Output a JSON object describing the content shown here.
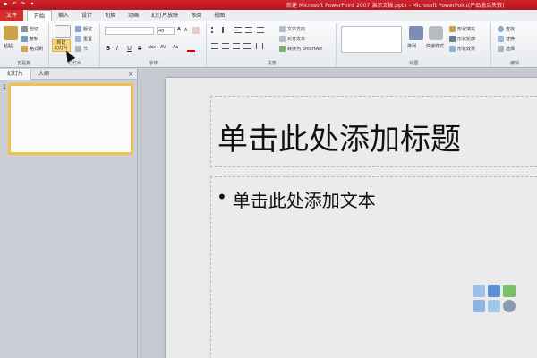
{
  "window": {
    "title": "新建 Microsoft PowerPoint 2007 演示文稿.pptx - Microsoft PowerPoint(产品激活失败)"
  },
  "quick_access": [
    "save-icon",
    "undo-icon",
    "redo-icon",
    "customize-icon"
  ],
  "tabs": [
    {
      "label": "文件",
      "type": "file"
    },
    {
      "label": "开始",
      "active": true
    },
    {
      "label": "插入"
    },
    {
      "label": "设计"
    },
    {
      "label": "切换"
    },
    {
      "label": "动画"
    },
    {
      "label": "幻灯片放映"
    },
    {
      "label": "审阅"
    },
    {
      "label": "视图"
    }
  ],
  "ribbon": {
    "clipboard": {
      "label": "剪贴板",
      "paste": "粘贴",
      "cut": "剪切",
      "copy": "复制",
      "format_painter": "格式刷"
    },
    "slides": {
      "label": "幻灯片",
      "new_slide": "新建\n幻灯片",
      "new_slide_l1": "新建",
      "new_slide_l2": "幻灯片",
      "layout": "版式",
      "reset": "重置",
      "section": "节"
    },
    "font": {
      "label": "字体",
      "font_size": "40",
      "bold": "B",
      "italic": "I",
      "underline": "U",
      "strike": "S",
      "shadow": "abc",
      "spacing": "AV",
      "case": "Aa",
      "grow": "A",
      "shrink": "A"
    },
    "paragraph": {
      "label": "段落",
      "text_direction": "文字方向",
      "align_text": "对齐文本",
      "convert_smartart": "转换为 SmartArt"
    },
    "drawing": {
      "label": "绘图",
      "arrange": "排列",
      "quick_styles": "快速样式",
      "shape_fill": "形状填充",
      "shape_outline": "形状轮廓",
      "shape_effects": "形状效果"
    },
    "editing": {
      "label": "编辑",
      "find": "查找",
      "replace": "替换",
      "select": "选择"
    }
  },
  "left_panel": {
    "tabs": [
      {
        "label": "幻灯片",
        "active": true
      },
      {
        "label": "大纲"
      }
    ],
    "close": "×",
    "slides": [
      {
        "number": "1"
      }
    ]
  },
  "slide": {
    "title_placeholder": "单击此处添加标题",
    "body_bullet": "•",
    "body_placeholder": "单击此处添加文本"
  },
  "colors": {
    "title_bar": "#c41e24",
    "file_tab": "#d0312d",
    "selected_thumb_border": "#f0c24a"
  }
}
